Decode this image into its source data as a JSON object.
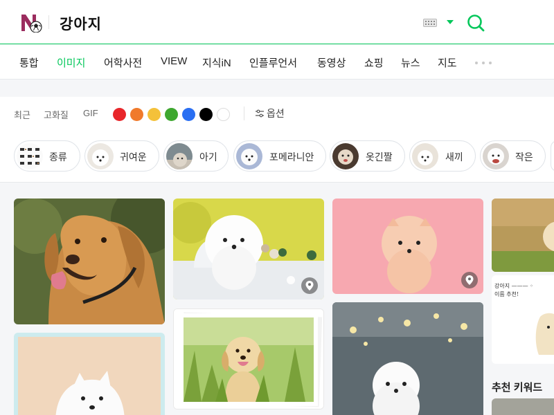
{
  "header": {
    "query": "강아지"
  },
  "icons": {
    "logo": "naver-logo-with-ball",
    "keyboard": "keyboard-icon",
    "dropdown": "chevron-down-icon",
    "search": "search-icon",
    "more": "more-dots-icon",
    "options": "sliders-icon",
    "pin": "map-pin-icon"
  },
  "colors": {
    "accent": "#03c75a",
    "swatches": [
      "#e8262a",
      "#f07a2b",
      "#f4c13a",
      "#3ea72f",
      "#2a6ff2",
      "#000000",
      "#ffffff"
    ]
  },
  "tabs": [
    "통합",
    "이미지",
    "어학사전",
    "VIEW",
    "지식iN",
    "인플루언서",
    "동영상",
    "쇼핑",
    "뉴스",
    "지도"
  ],
  "active_tab": "이미지",
  "filters": {
    "recent": "최근",
    "hd": "고화질",
    "gif": "GIF",
    "options": "옵션"
  },
  "chips": [
    "종류",
    "귀여운",
    "아기",
    "포메라니안",
    "옷긴짤",
    "새끼",
    "작은"
  ],
  "sidebar": {
    "recommended_title": "추천 키워드",
    "note_line1": "강아지 ——— ◦",
    "note_line2": "이름 추천!"
  }
}
